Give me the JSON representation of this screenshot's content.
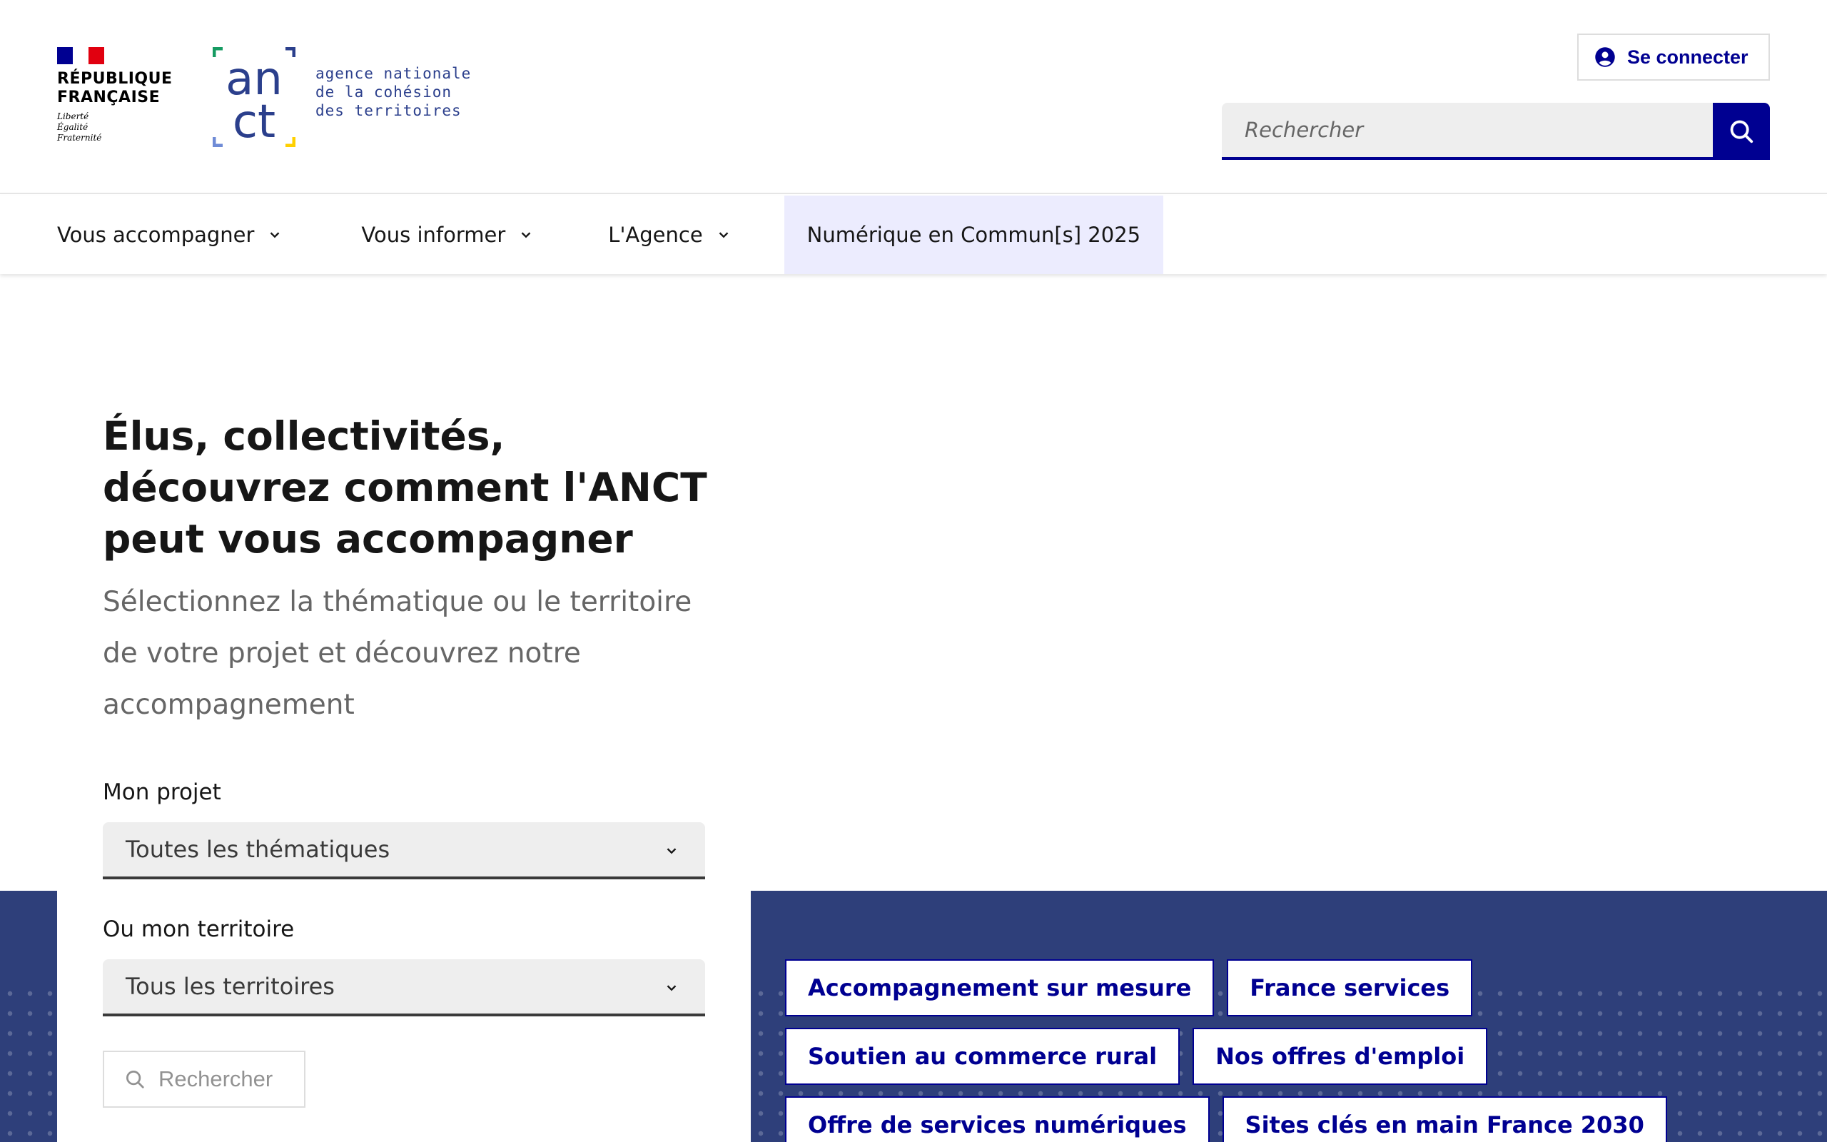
{
  "header": {
    "rf_logo": {
      "name_line1": "RÉPUBLIQUE",
      "name_line2": "FRANÇAISE",
      "motto_line1": "Liberté",
      "motto_line2": "Égalité",
      "motto_line3": "Fraternité"
    },
    "anct_logo": {
      "text": "anct",
      "tagline_line1": "agence nationale",
      "tagline_line2": "de la cohésion",
      "tagline_line3": "des territoires"
    },
    "login_label": "Se connecter",
    "search_placeholder": "Rechercher"
  },
  "nav": {
    "items": [
      {
        "label": "Vous accompagner",
        "dropdown": true
      },
      {
        "label": "Vous informer",
        "dropdown": true
      },
      {
        "label": "L'Agence",
        "dropdown": true
      },
      {
        "label": "Numérique en Commun[s] 2025",
        "dropdown": false
      }
    ]
  },
  "hero": {
    "title": "Élus, collectivités, découvrez comment l'ANCT peut vous accompagner",
    "subtitle": "Sélectionnez la thématique ou le territoire de votre projet et découvrez notre accompagnement"
  },
  "form": {
    "project_label": "Mon projet",
    "project_value": "Toutes les thématiques",
    "territory_label": "Ou mon territoire",
    "territory_value": "Tous les territoires",
    "search_label": "Rechercher"
  },
  "tags": [
    "Accompagnement sur mesure",
    "France services",
    "Soutien au commerce rural",
    "Nos offres d'emploi",
    "Offre de services numériques",
    "Sites clés en main France 2030"
  ],
  "colors": {
    "primary": "#000091",
    "band": "#2e3f7a",
    "nav_active_bg": "#ececfe",
    "flag_blue": "#000091",
    "flag_red": "#e1000f",
    "anct_text": "#2b3f8c"
  },
  "icons": {
    "login": "user-circle-icon",
    "search": "search-icon",
    "dropdown": "chevron-down-icon"
  }
}
